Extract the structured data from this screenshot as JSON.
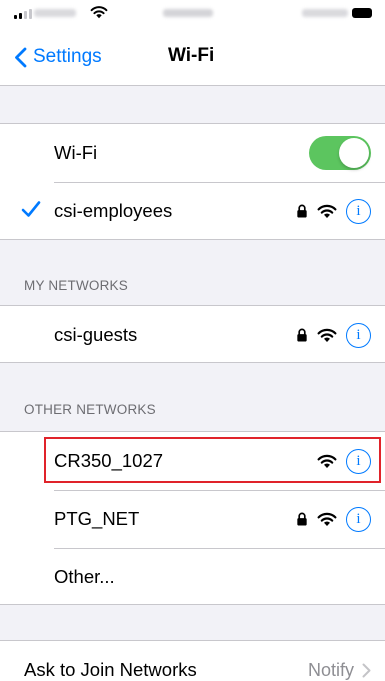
{
  "status_bar": {
    "icons": [
      "signal-icon",
      "wifi-icon",
      "battery-icon"
    ]
  },
  "nav": {
    "back_label": "Settings",
    "title": "Wi-Fi"
  },
  "wifi_toggle": {
    "label": "Wi-Fi",
    "state": "on",
    "color": "#5cc55f"
  },
  "connected_network": {
    "name": "csi-employees",
    "secured": true,
    "connected": true
  },
  "my_networks": {
    "header": "MY NETWORKS",
    "items": [
      {
        "name": "csi-guests",
        "secured": true
      }
    ]
  },
  "other_networks": {
    "header": "OTHER NETWORKS",
    "items": [
      {
        "name": "CR350_1027",
        "secured": false,
        "highlighted": true
      },
      {
        "name": "PTG_NET",
        "secured": true
      }
    ],
    "other_label": "Other..."
  },
  "ask_to_join": {
    "label": "Ask to Join Networks",
    "value": "Notify"
  },
  "colors": {
    "accent": "#007aff",
    "toggle_on": "#5cc55f",
    "highlight_box": "#e0232a",
    "group_background": "#f2f2f7"
  }
}
